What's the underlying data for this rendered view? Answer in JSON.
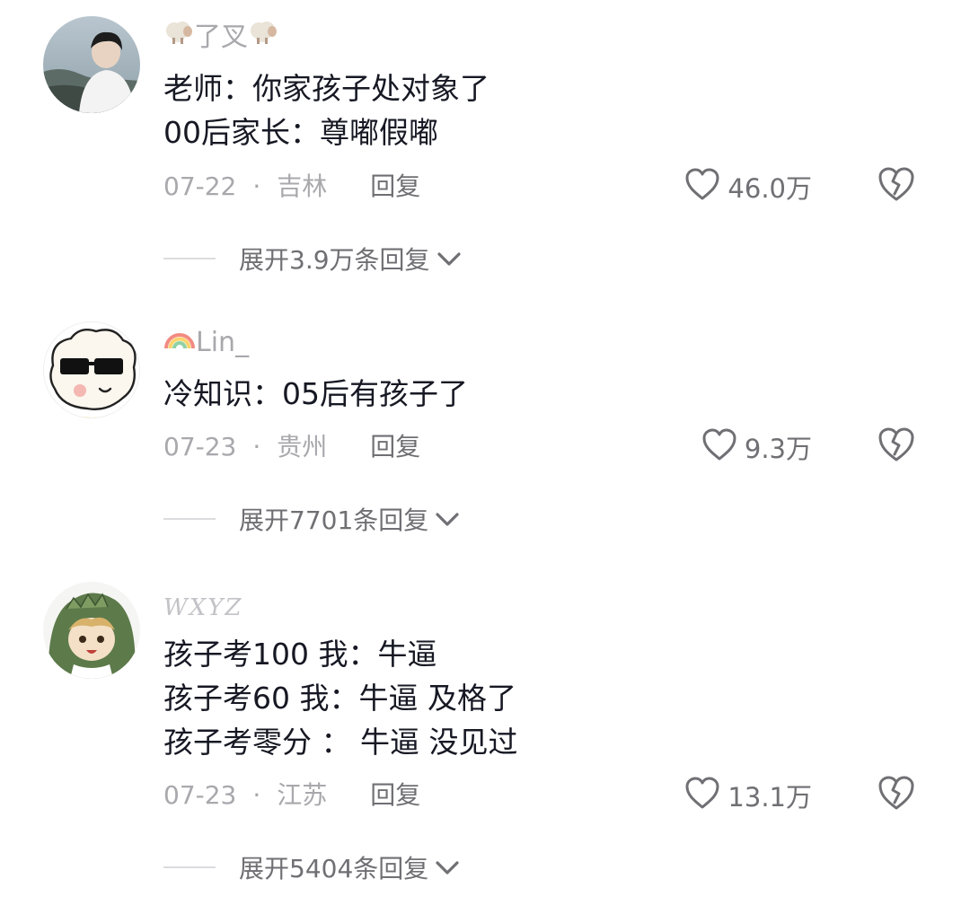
{
  "comments": [
    {
      "username": "了叉",
      "body": [
        "老师：你家孩子处对象了",
        "00后家长：尊嘟假嘟"
      ],
      "date": "07-22",
      "location": "吉林",
      "reply_label": "回复",
      "likes": "46.0万",
      "expand_label": "展开3.9万条回复"
    },
    {
      "username": "Lin_",
      "body": [
        "冷知识：05后有孩子了"
      ],
      "date": "07-23",
      "location": "贵州",
      "reply_label": "回复",
      "likes": "9.3万",
      "expand_label": "展开7701条回复"
    },
    {
      "username": "WXYZ",
      "body": [
        "孩子考100 我：牛逼",
        "孩子考60 我：牛逼 及格了",
        "孩子考零分 ：  牛逼 没见过"
      ],
      "date": "07-23",
      "location": "江苏",
      "reply_label": "回复",
      "likes": "13.1万",
      "expand_label": "展开5404条回复"
    }
  ],
  "icons": {
    "like": "heart-outline-icon",
    "dislike": "broken-heart-icon",
    "expand": "chevron-down-icon"
  },
  "colors": {
    "text": "#161823",
    "muted": "#a8a8ad",
    "secondary": "#6f6f74"
  }
}
